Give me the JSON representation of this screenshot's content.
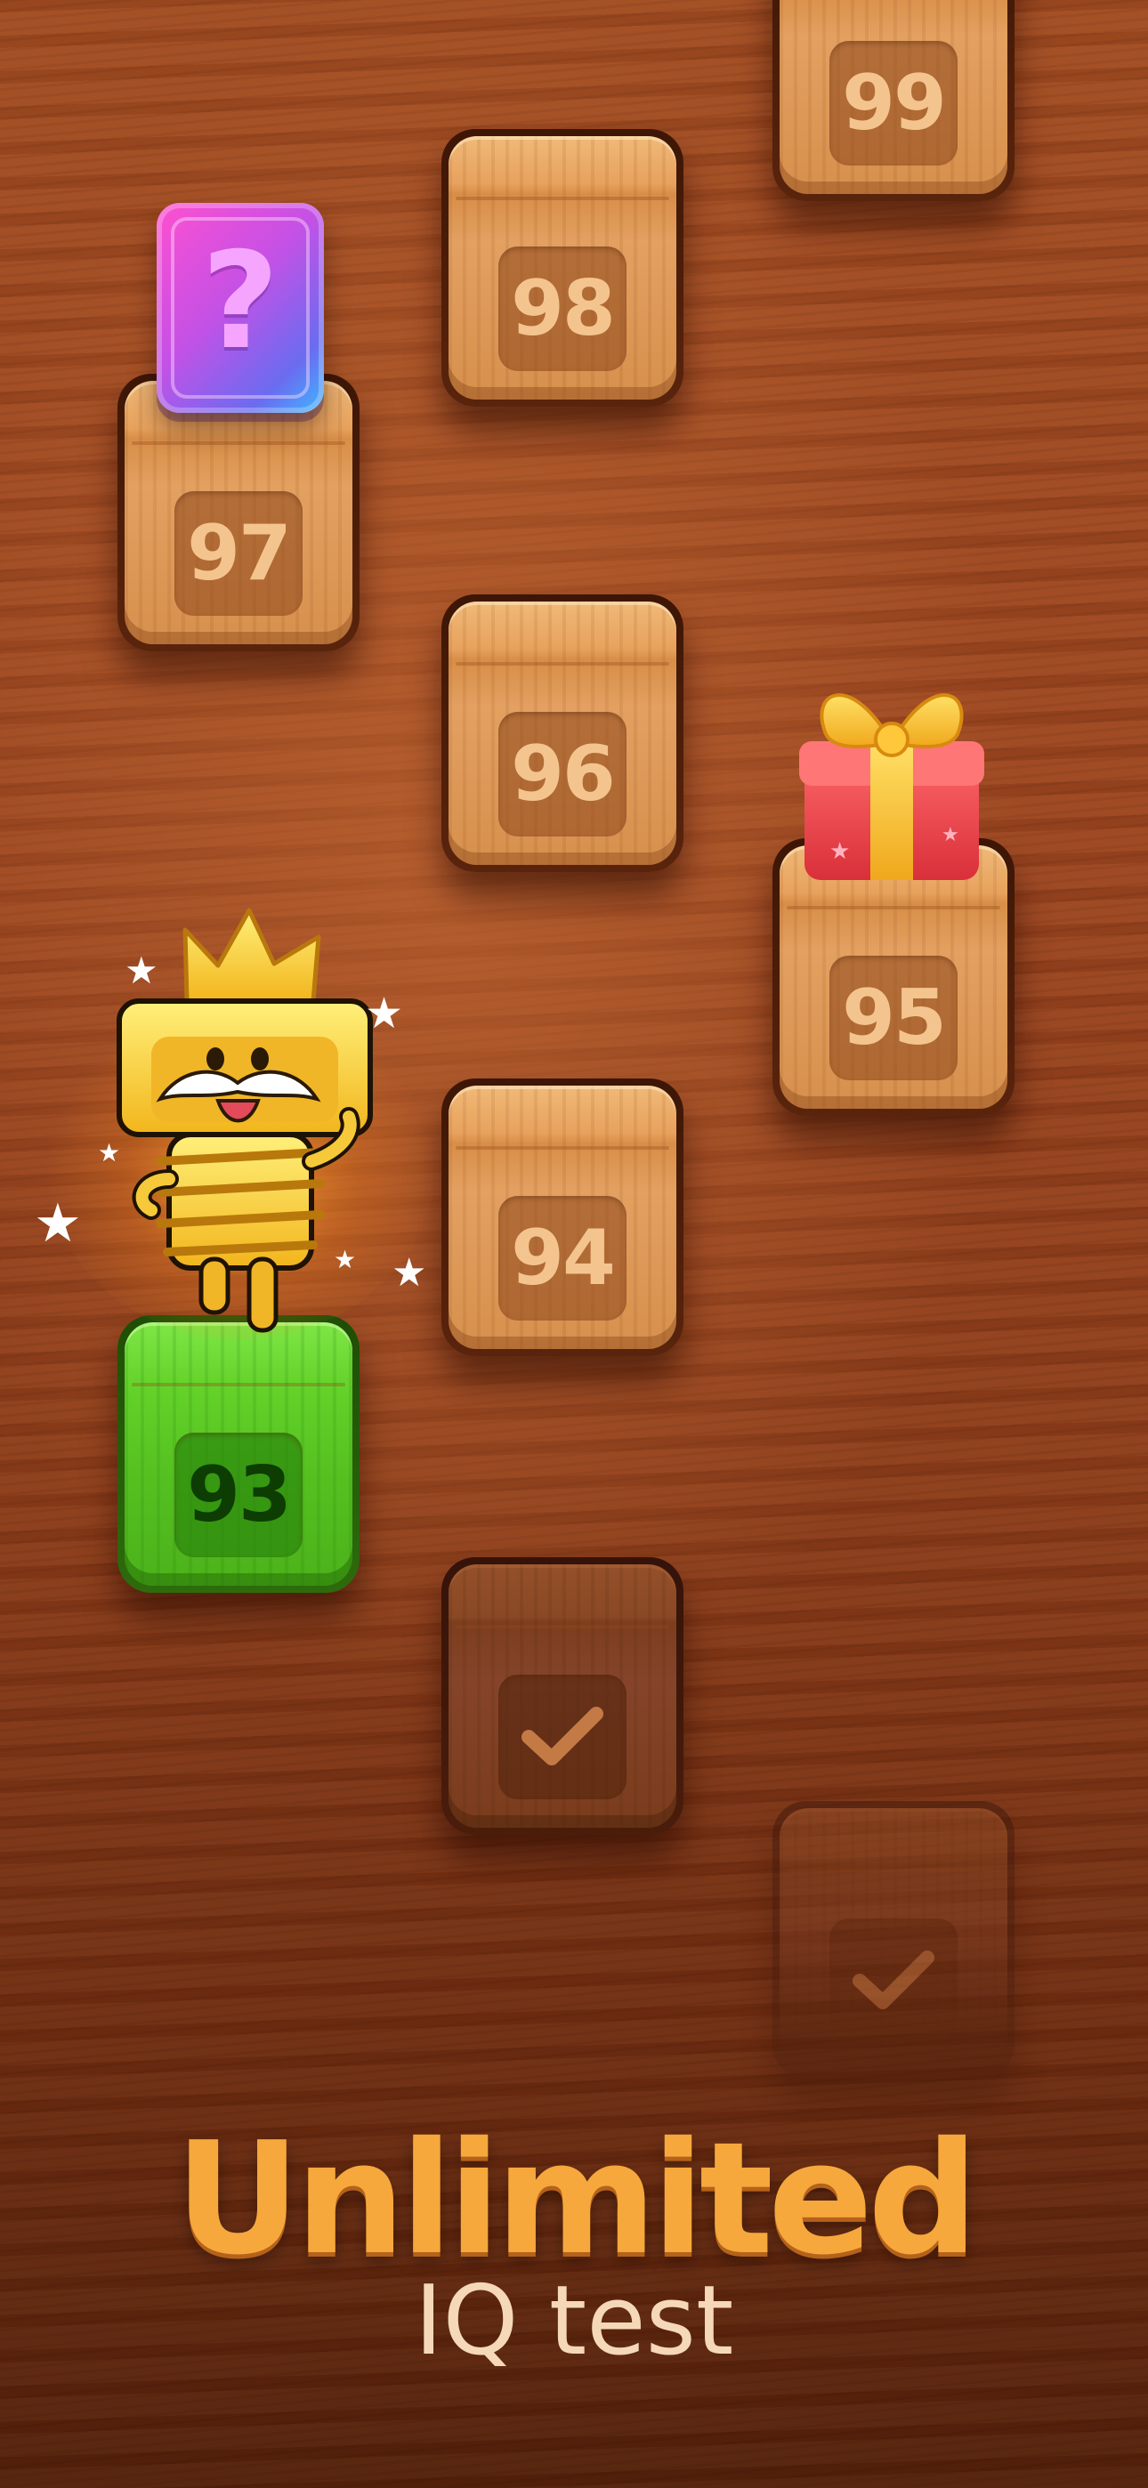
{
  "levels": [
    {
      "label": "99",
      "state": "locked"
    },
    {
      "label": "98",
      "state": "locked"
    },
    {
      "label": "97",
      "state": "locked",
      "reward": "mystery-card"
    },
    {
      "label": "96",
      "state": "locked"
    },
    {
      "label": "95",
      "state": "locked",
      "reward": "gift-box"
    },
    {
      "label": "94",
      "state": "locked"
    },
    {
      "label": "93",
      "state": "current"
    },
    {
      "label": "",
      "state": "completed",
      "icon": "check-icon"
    },
    {
      "label": "",
      "state": "completed",
      "icon": "check-icon"
    }
  ],
  "mystery_card": {
    "symbol": "?",
    "icon": "question-card-icon"
  },
  "gift": {
    "icon": "gift-box-icon"
  },
  "mascot": {
    "icon": "golden-screw-king-mascot"
  },
  "headline": {
    "title": "Unlimited",
    "subtitle": "IQ test"
  },
  "colors": {
    "wood": "#9a4520",
    "tile": "#e3a060",
    "current_tile": "#5cc923",
    "headline": "#f6a83c",
    "subline": "#f5d8b8"
  }
}
